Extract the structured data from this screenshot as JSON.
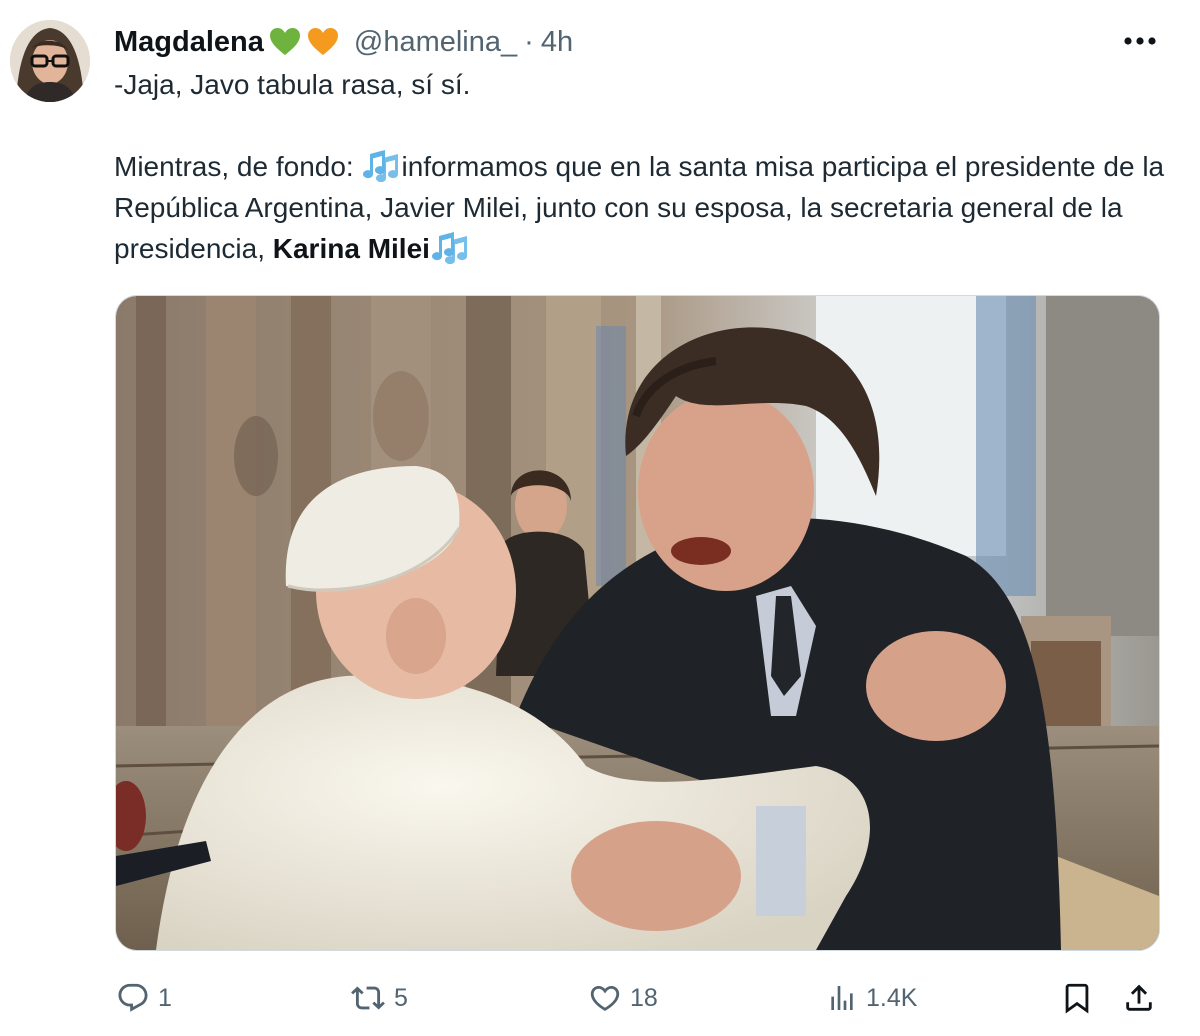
{
  "author": {
    "display_name": "Magdalena",
    "emoji_1": "green-heart",
    "emoji_2": "orange-heart",
    "handle": "@hamelina_",
    "separator": "·",
    "time": "4h"
  },
  "tweet": {
    "line_1": "-Jaja, Javo tabula rasa, sí sí.",
    "paragraph_2_intro": "Mientras, de fondo: ",
    "paragraph_2_body": "informamos que en la santa misa participa el presidente de la República Argentina, Javier Milei, junto con su esposa, la secretaria general de la presidencia, ",
    "paragraph_2_bold": "Karina Milei"
  },
  "actions": {
    "reply_count": "1",
    "repost_count": "5",
    "like_count": "18",
    "views_count": "1.4K"
  },
  "icons": {
    "more": "more-horizontal-icon",
    "reply": "reply-icon",
    "repost": "repost-icon",
    "like": "heart-icon",
    "views": "analytics-icon",
    "bookmark": "bookmark-icon",
    "share": "share-icon"
  },
  "colors": {
    "text_primary": "#0f1419",
    "text_secondary": "#536471",
    "green_heart": "#6fb33f",
    "orange_heart": "#f39a1f",
    "music_notes": "#5fb3e6"
  }
}
